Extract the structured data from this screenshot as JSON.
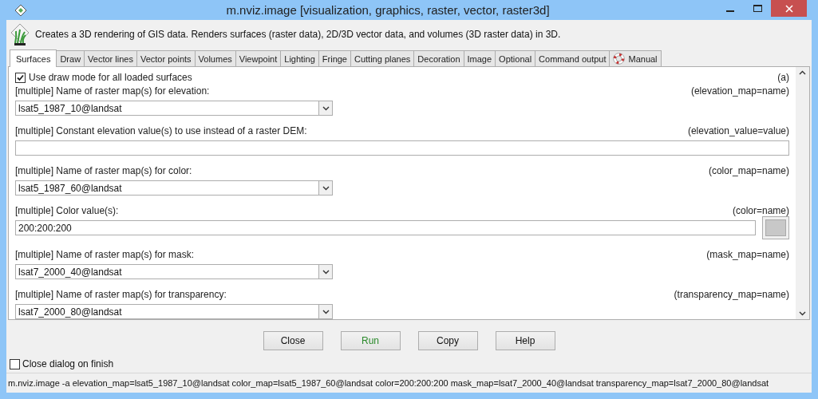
{
  "window": {
    "title": "m.nviz.image [visualization, graphics, raster, vector, raster3d]"
  },
  "description": "Creates a 3D rendering of GIS data. Renders surfaces (raster data), 2D/3D vector data, and volumes (3D raster data) in 3D.",
  "tabs": [
    {
      "label": "Surfaces",
      "selected": true,
      "kind": "plain"
    },
    {
      "label": "Draw",
      "selected": false,
      "kind": "plain"
    },
    {
      "label": "Vector lines",
      "selected": false,
      "kind": "plain"
    },
    {
      "label": "Vector points",
      "selected": false,
      "kind": "plain"
    },
    {
      "label": "Volumes",
      "selected": false,
      "kind": "plain"
    },
    {
      "label": "Viewpoint",
      "selected": false,
      "kind": "plain"
    },
    {
      "label": "Lighting",
      "selected": false,
      "kind": "plain"
    },
    {
      "label": "Fringe",
      "selected": false,
      "kind": "plain"
    },
    {
      "label": "Cutting planes",
      "selected": false,
      "kind": "plain"
    },
    {
      "label": "Decoration",
      "selected": false,
      "kind": "plain"
    },
    {
      "label": "Image",
      "selected": false,
      "kind": "plain"
    },
    {
      "label": "Optional",
      "selected": false,
      "kind": "plain"
    },
    {
      "label": "Command output",
      "selected": false,
      "kind": "plain"
    },
    {
      "label": "Manual",
      "selected": false,
      "kind": "manual"
    }
  ],
  "flag": {
    "label": "Use draw mode for all loaded surfaces",
    "checked": true,
    "key": "(a)"
  },
  "params": [
    {
      "kind": "combo",
      "label": "[multiple] Name of raster map(s) for elevation:",
      "key": "(elevation_map=name)",
      "value": "lsat5_1987_10@landsat"
    },
    {
      "kind": "text",
      "label": "[multiple] Constant elevation value(s) to use instead of a raster DEM:",
      "key": "(elevation_value=value)"
    },
    {
      "kind": "combo",
      "label": "[multiple] Name of raster map(s) for color:",
      "key": "(color_map=name)",
      "value": "lsat5_1987_60@landsat"
    },
    {
      "kind": "color",
      "label": "[multiple] Color value(s):",
      "key": "(color=name)",
      "value": "200:200:200"
    },
    {
      "kind": "combo",
      "label": "[multiple] Name of raster map(s) for mask:",
      "key": "(mask_map=name)",
      "value": "lsat7_2000_40@landsat"
    },
    {
      "kind": "combo",
      "label": "[multiple] Name of raster map(s) for transparency:",
      "key": "(transparency_map=name)",
      "value": "lsat7_2000_80@landsat"
    }
  ],
  "buttons": [
    {
      "label": "Close",
      "kind": "normal"
    },
    {
      "label": "Run",
      "kind": "run"
    },
    {
      "label": "Copy",
      "kind": "normal"
    },
    {
      "label": "Help",
      "kind": "normal"
    }
  ],
  "close_on_finish": {
    "label": "Close dialog on finish",
    "checked": false
  },
  "status_bar": "m.nviz.image -a elevation_map=lsat5_1987_10@landsat color_map=lsat5_1987_60@landsat color=200:200:200 mask_map=lsat7_2000_40@landsat transparency_map=lsat7_2000_80@landsat"
}
